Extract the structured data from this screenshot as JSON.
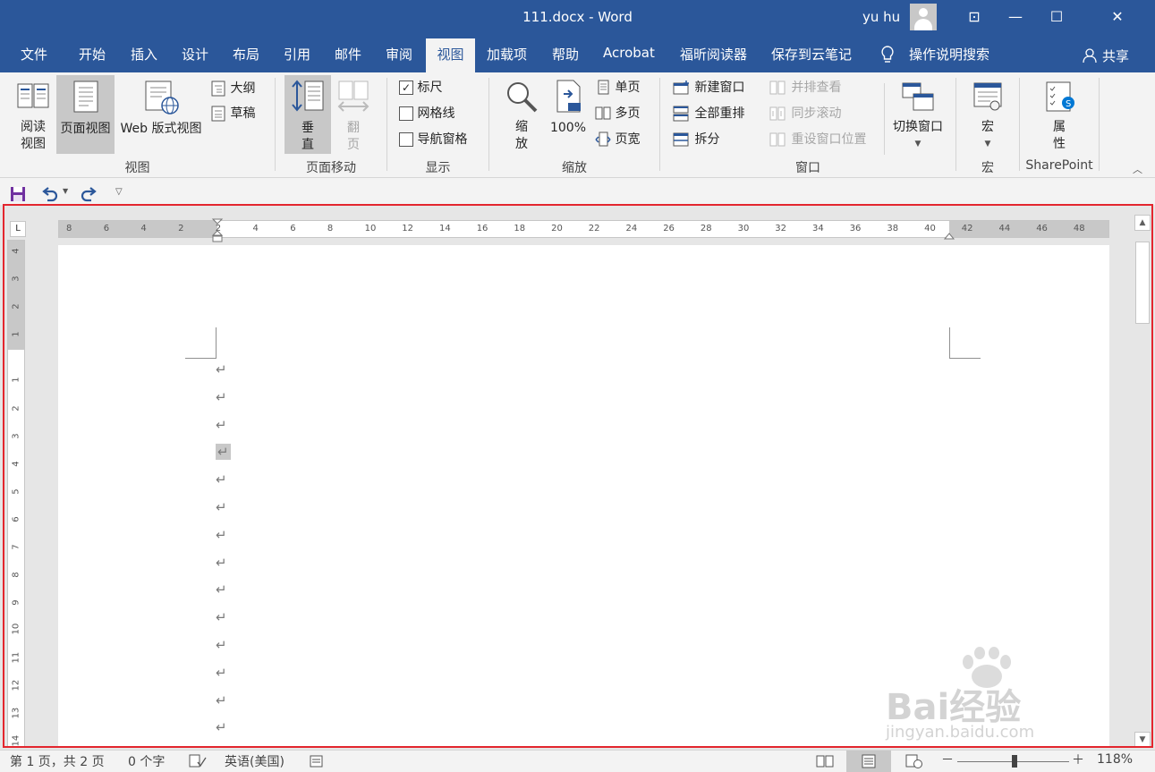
{
  "titlebar": {
    "doc_title": "111.docx  -  Word",
    "user_name": "yu hu",
    "minimize": "—",
    "maximize": "☐",
    "close": "✕",
    "ribbon_display": "⊡"
  },
  "tabs": [
    {
      "label": "文件"
    },
    {
      "label": "开始"
    },
    {
      "label": "插入"
    },
    {
      "label": "设计"
    },
    {
      "label": "布局"
    },
    {
      "label": "引用"
    },
    {
      "label": "邮件"
    },
    {
      "label": "审阅"
    },
    {
      "label": "视图"
    },
    {
      "label": "加载项"
    },
    {
      "label": "帮助"
    },
    {
      "label": "Acrobat"
    },
    {
      "label": "福昕阅读器"
    },
    {
      "label": "保存到云笔记"
    }
  ],
  "tell_me": "操作说明搜索",
  "share": "共享",
  "ribbon": {
    "views": {
      "label": "视图",
      "read_mode_1": "阅读",
      "read_mode_2": "视图",
      "print_layout": "页面视图",
      "web_layout": "Web 版式视图",
      "outline": "大纲",
      "draft": "草稿"
    },
    "page_movement": {
      "label": "页面移动",
      "vertical_1": "垂",
      "vertical_2": "直",
      "side_1": "翻",
      "side_2": "页"
    },
    "show": {
      "label": "显示",
      "ruler": "标尺",
      "gridlines": "网格线",
      "nav_pane": "导航窗格",
      "ruler_checked": "✓"
    },
    "zoom": {
      "label": "缩放",
      "zoom_1": "缩",
      "zoom_2": "放",
      "hundred": "100%",
      "one_page": "单页",
      "multiple_pages": "多页",
      "page_width": "页宽"
    },
    "window": {
      "label": "窗口",
      "new_window": "新建窗口",
      "arrange_all": "全部重排",
      "split": "拆分",
      "side_by_side": "并排查看",
      "sync_scroll": "同步滚动",
      "reset_position": "重设窗口位置",
      "switch_windows": "切换窗口"
    },
    "macros": {
      "label": "宏",
      "button": "宏"
    },
    "sharepoint": {
      "label": "SharePoint",
      "properties_1": "属",
      "properties_2": "性"
    }
  },
  "ruler": {
    "h_ticks": [
      "8",
      "6",
      "4",
      "2",
      "2",
      "4",
      "6",
      "8",
      "10",
      "12",
      "14",
      "16",
      "18",
      "20",
      "22",
      "24",
      "26",
      "28",
      "30",
      "32",
      "34",
      "36",
      "38",
      "40",
      "42",
      "44",
      "46",
      "48"
    ],
    "v_ticks": [
      "4",
      "3",
      "2",
      "1",
      "1",
      "2",
      "3",
      "4",
      "5",
      "6",
      "7",
      "8",
      "9",
      "10",
      "11",
      "12",
      "13",
      "14"
    ]
  },
  "document": {
    "paragraph_mark": "↵",
    "paragraph_count": 14
  },
  "statusbar": {
    "page": "第 1 页，共 2 页",
    "words": "0 个字",
    "language": "英语(美国)",
    "zoom": "118%",
    "minus": "－",
    "plus": "＋"
  },
  "watermark": {
    "brand": "Bai经验",
    "url": "jingyan.baidu.com"
  },
  "colors": {
    "word_blue": "#2b579a",
    "highlight_red": "#e3262e",
    "ribbon_bg": "#f3f3f3"
  }
}
